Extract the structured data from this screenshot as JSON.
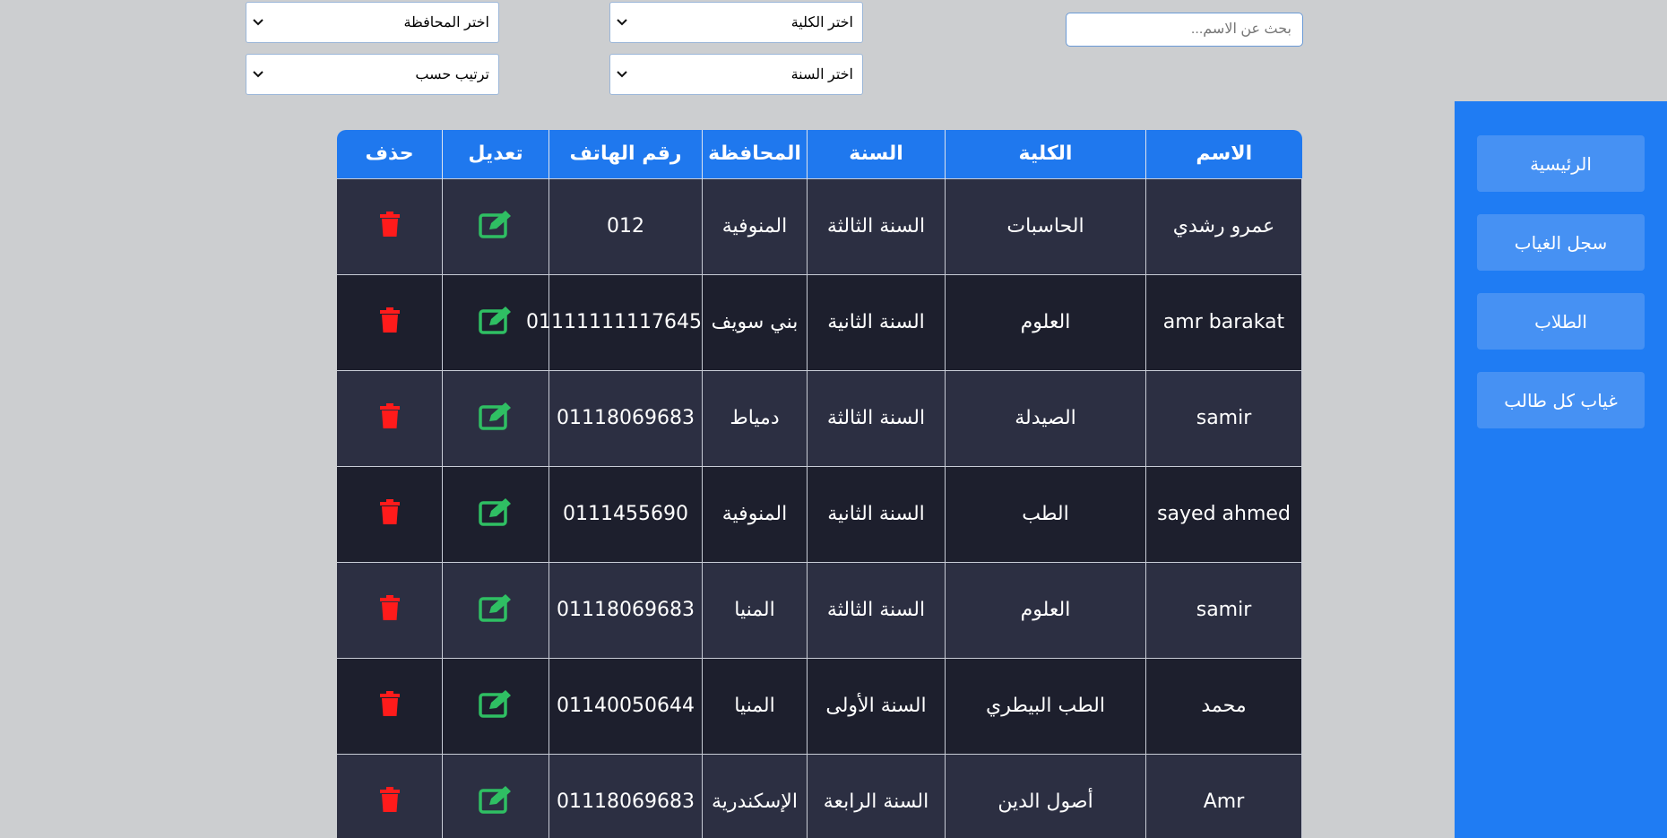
{
  "search": {
    "placeholder": "بحث عن الاسم..."
  },
  "filters": {
    "college": "اختر الكلية",
    "governorate": "اختر المحافظة",
    "year": "اختر السنة",
    "sort": "ترتيب حسب"
  },
  "sidebar": {
    "items": [
      {
        "label": "الرئيسية"
      },
      {
        "label": "سجل الغياب"
      },
      {
        "label": "الطلاب"
      },
      {
        "label": "غياب كل طالب"
      }
    ]
  },
  "table": {
    "headers": {
      "name": "الاسم",
      "college": "الكلية",
      "year": "السنة",
      "governorate": "المحافظة",
      "phone": "رقم الهاتف",
      "edit": "تعديل",
      "delete": "حذف"
    },
    "rows": [
      {
        "name": "عمرو رشدي",
        "college": "الحاسبات",
        "year": "السنة الثالثة",
        "governorate": "المنوفية",
        "phone": "012"
      },
      {
        "name": "amr barakat",
        "college": "العلوم",
        "year": "السنة الثانية",
        "governorate": "بني سويف",
        "phone": "01111111117645"
      },
      {
        "name": "samir",
        "college": "الصيدلة",
        "year": "السنة الثالثة",
        "governorate": "دمياط",
        "phone": "01118069683"
      },
      {
        "name": "sayed ahmed",
        "college": "الطب",
        "year": "السنة الثانية",
        "governorate": "المنوفية",
        "phone": "0111455690"
      },
      {
        "name": "samir",
        "college": "العلوم",
        "year": "السنة الثالثة",
        "governorate": "المنيا",
        "phone": "01118069683"
      },
      {
        "name": "محمد",
        "college": "الطب البيطري",
        "year": "السنة الأولى",
        "governorate": "المنيا",
        "phone": "01140050644"
      },
      {
        "name": "Amr",
        "college": "أصول الدين",
        "year": "السنة الرابعة",
        "governorate": "الإسكندرية",
        "phone": "01118069683"
      }
    ]
  },
  "colors": {
    "sidebar": "#1f7cf3",
    "header": "#1f78ee",
    "edit_icon": "#2fbf63",
    "delete_icon": "#ff1b1b"
  },
  "icons": {
    "edit": "edit-square-icon",
    "delete": "trash-icon",
    "select": "chevron-down-icon"
  }
}
